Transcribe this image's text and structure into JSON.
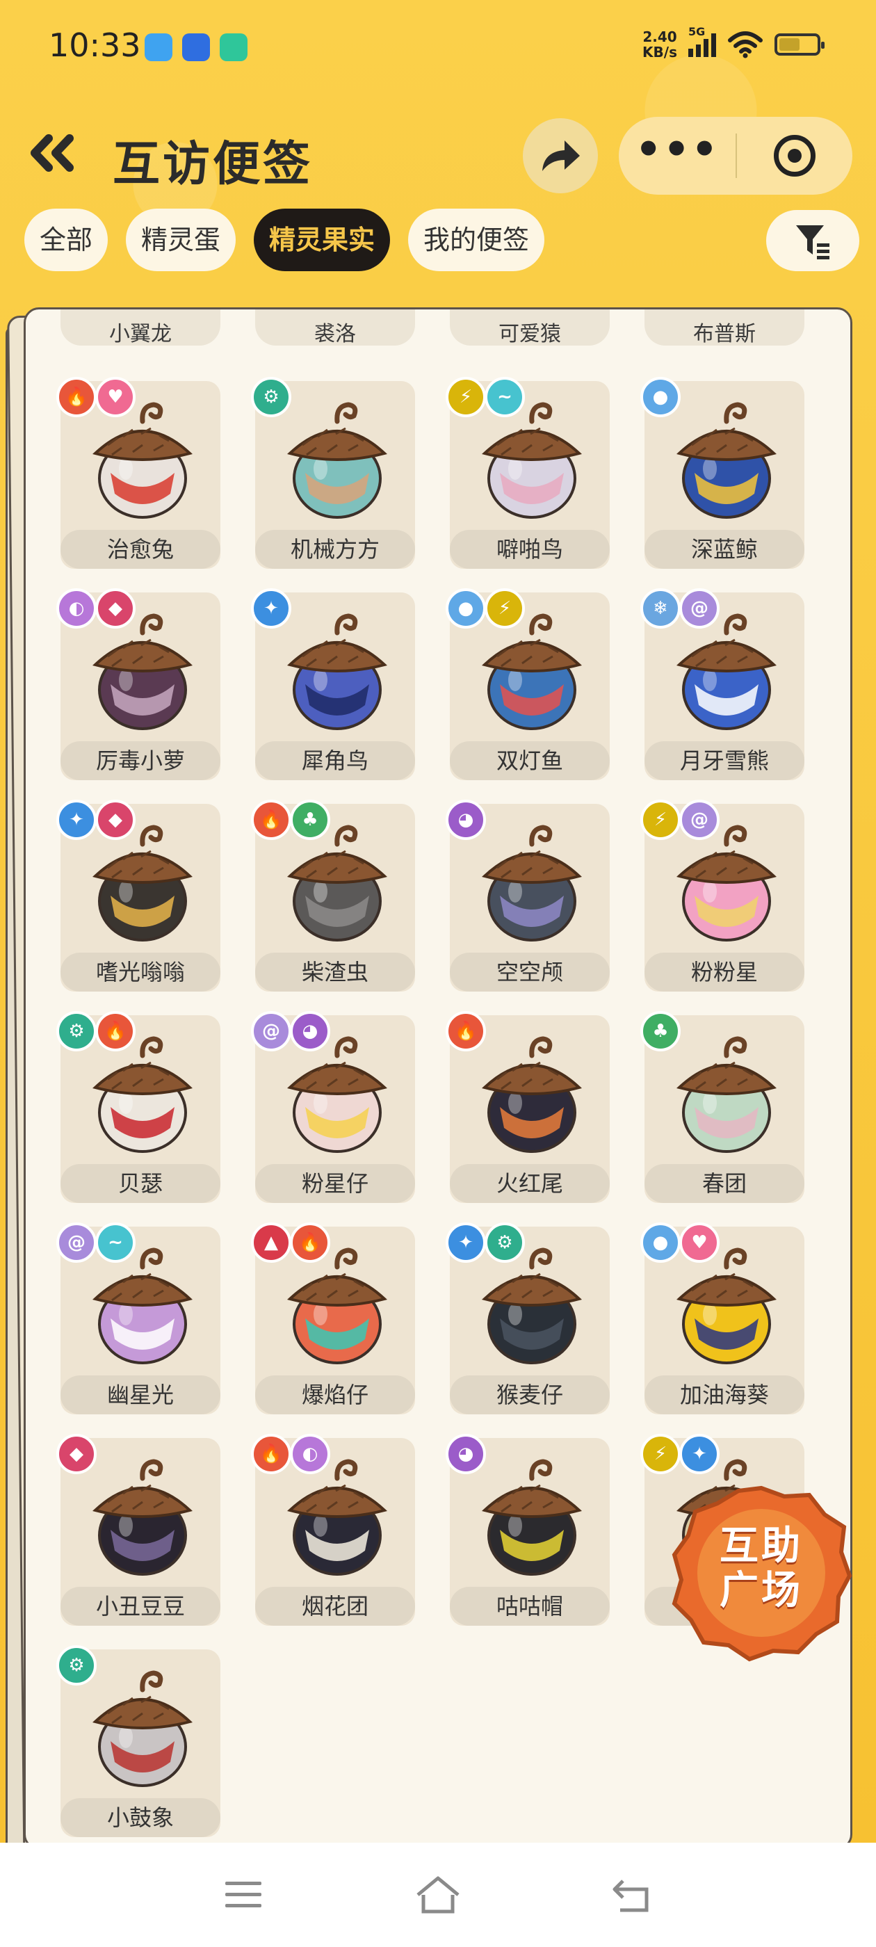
{
  "status_bar": {
    "time": "10:33",
    "net_speed_value": "2.40",
    "net_speed_unit": "KB/s",
    "signal_label": "5G"
  },
  "header": {
    "title": "互访便签"
  },
  "tabs": [
    {
      "label": "全部",
      "active": false
    },
    {
      "label": "精灵蛋",
      "active": false
    },
    {
      "label": "精灵果实",
      "active": true
    },
    {
      "label": "我的便签",
      "active": false
    }
  ],
  "partial_row": [
    "小翼龙",
    "裘洛",
    "可爱猿",
    "布普斯"
  ],
  "items": [
    {
      "name": "治愈兔",
      "badges": [
        "fire",
        "heart"
      ],
      "body": "#e9e2dc",
      "accent": "#d83a2e"
    },
    {
      "name": "机械方方",
      "badges": [
        "gear"
      ],
      "body": "#7fc0bc",
      "accent": "#d8a37a"
    },
    {
      "name": "噼啪鸟",
      "badges": [
        "bolt",
        "wing"
      ],
      "body": "#d9d3e1",
      "accent": "#e8a9bf"
    },
    {
      "name": "深蓝鲸",
      "badges": [
        "water"
      ],
      "body": "#2f52a8",
      "accent": "#f3c43a"
    },
    {
      "name": "厉毒小萝",
      "badges": [
        "poison",
        "demon"
      ],
      "body": "#5a3a52",
      "accent": "#c7a8c0"
    },
    {
      "name": "犀角鸟",
      "badges": [
        "star"
      ],
      "body": "#4d5fbf",
      "accent": "#1f2a66"
    },
    {
      "name": "双灯鱼",
      "badges": [
        "water",
        "bolt"
      ],
      "body": "#3c74b8",
      "accent": "#e4524e"
    },
    {
      "name": "月牙雪熊",
      "badges": [
        "ice",
        "wind"
      ],
      "body": "#3b63c8",
      "accent": "#ffffff"
    },
    {
      "name": "嗜光嗡嗡",
      "badges": [
        "star",
        "demon"
      ],
      "body": "#3a3530",
      "accent": "#e7b44a"
    },
    {
      "name": "柴渣虫",
      "badges": [
        "fire",
        "leaf"
      ],
      "body": "#5b5958",
      "accent": "#8d8b8a"
    },
    {
      "name": "空空颅",
      "badges": [
        "ghost"
      ],
      "body": "#48505e",
      "accent": "#8f88c7"
    },
    {
      "name": "粉粉星",
      "badges": [
        "bolt",
        "wind"
      ],
      "body": "#f2a2c3",
      "accent": "#f0d46a"
    },
    {
      "name": "贝瑟",
      "badges": [
        "gear",
        "fire"
      ],
      "body": "#ece6dd",
      "accent": "#c9252d"
    },
    {
      "name": "粉星仔",
      "badges": [
        "wind",
        "ghost"
      ],
      "body": "#efd8d3",
      "accent": "#f6d14e"
    },
    {
      "name": "火红尾",
      "badges": [
        "fire"
      ],
      "body": "#2e2b3a",
      "accent": "#e77d3b"
    },
    {
      "name": "春团",
      "badges": [
        "leaf"
      ],
      "body": "#bfd9c3",
      "accent": "#e5b6c3"
    },
    {
      "name": "幽星光",
      "badges": [
        "wind",
        "wing"
      ],
      "body": "#c59ad8",
      "accent": "#ffffff"
    },
    {
      "name": "爆焰仔",
      "badges": [
        "dragon",
        "fire"
      ],
      "body": "#e86a4b",
      "accent": "#3bc7b4"
    },
    {
      "name": "猴麦仔",
      "badges": [
        "star",
        "gear"
      ],
      "body": "#2a3038",
      "accent": "#4a5460"
    },
    {
      "name": "加油海葵",
      "badges": [
        "water",
        "heart"
      ],
      "body": "#f0c21b",
      "accent": "#2a3580"
    },
    {
      "name": "小丑豆豆",
      "badges": [
        "demon"
      ],
      "body": "#2a2530",
      "accent": "#7a6a9a"
    },
    {
      "name": "烟花团",
      "badges": [
        "fire",
        "poison"
      ],
      "body": "#2a2936",
      "accent": "#f4eee0"
    },
    {
      "name": "咕咕帽",
      "badges": [
        "ghost"
      ],
      "body": "#2b2a2e",
      "accent": "#e8d534"
    },
    {
      "name": "",
      "badges": [
        "bolt",
        "star"
      ],
      "body": "#d9c9a0",
      "accent": "#9a8a70"
    },
    {
      "name": "小鼓象",
      "badges": [
        "gear"
      ],
      "body": "#c9c4c4",
      "accent": "#b8332f"
    }
  ],
  "floating_button": {
    "line1": "互助",
    "line2": "广场"
  },
  "badge_colors": {
    "fire": "#e8563a",
    "heart": "#f06a92",
    "gear": "#2fae8d",
    "bolt": "#d9b50a",
    "wing": "#47c3cf",
    "water": "#5fa8e6",
    "poison": "#b777d9",
    "demon": "#d9456b",
    "star": "#3c8fe0",
    "ice": "#6aa6e0",
    "wind": "#a88bdb",
    "leaf": "#3fae64",
    "ghost": "#9b5cc9",
    "dragon": "#d93a4a"
  }
}
